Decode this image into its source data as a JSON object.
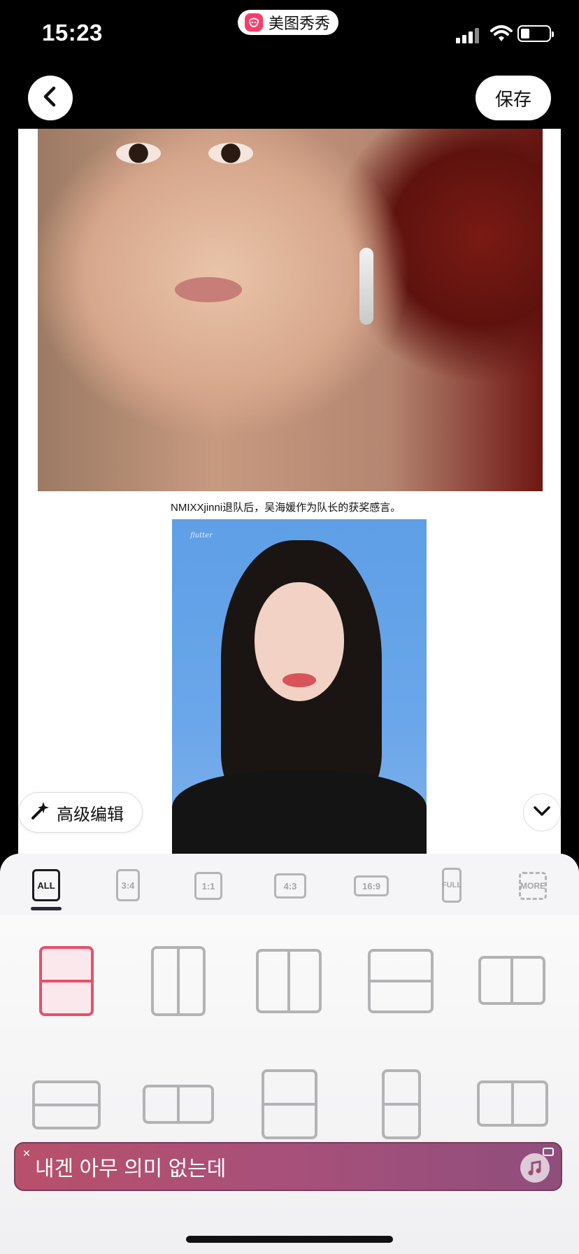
{
  "status_bar": {
    "time": "15:23",
    "app_badge": "美图秀秀"
  },
  "header": {
    "back_icon": "chevron-left-icon",
    "save_label": "保存"
  },
  "canvas": {
    "caption": "NMIXXjinni退队后，吴海媛作为队长的获奖感言。",
    "watermark": "flutter"
  },
  "tools": {
    "advanced_edit_label": "高级编辑",
    "advanced_edit_icon": "magic-wand-icon",
    "collapse_icon": "chevron-down-icon"
  },
  "ratio_tabs": [
    {
      "label": "ALL",
      "selected": true
    },
    {
      "label": "3:4",
      "selected": false
    },
    {
      "label": "1:1",
      "selected": false
    },
    {
      "label": "4:3",
      "selected": false
    },
    {
      "label": "16:9",
      "selected": false
    },
    {
      "label": "FULL",
      "selected": false
    },
    {
      "label": "MORE",
      "selected": false
    }
  ],
  "layouts": [
    {
      "id": "split-horizontal-3-4",
      "selected": true
    },
    {
      "id": "split-vertical-3-4",
      "selected": false
    },
    {
      "id": "split-vertical-1-1",
      "selected": false
    },
    {
      "id": "split-horizontal-4-3",
      "selected": false
    },
    {
      "id": "split-vertical-16-9",
      "selected": false
    },
    {
      "id": "split-horizontal-wide",
      "selected": false
    },
    {
      "id": "split-vertical-wide",
      "selected": false
    },
    {
      "id": "split-horizontal-tall",
      "selected": false
    },
    {
      "id": "split-horizontal-narrow",
      "selected": false
    },
    {
      "id": "split-vertical-wide-2",
      "selected": false
    }
  ],
  "lyric_banner": {
    "text": "내겐 아무 의미 없는데",
    "icon": "music-note-icon"
  },
  "colors": {
    "accent": "#e8506a",
    "lyric_bg": "#a7507a",
    "black": "#000000"
  }
}
